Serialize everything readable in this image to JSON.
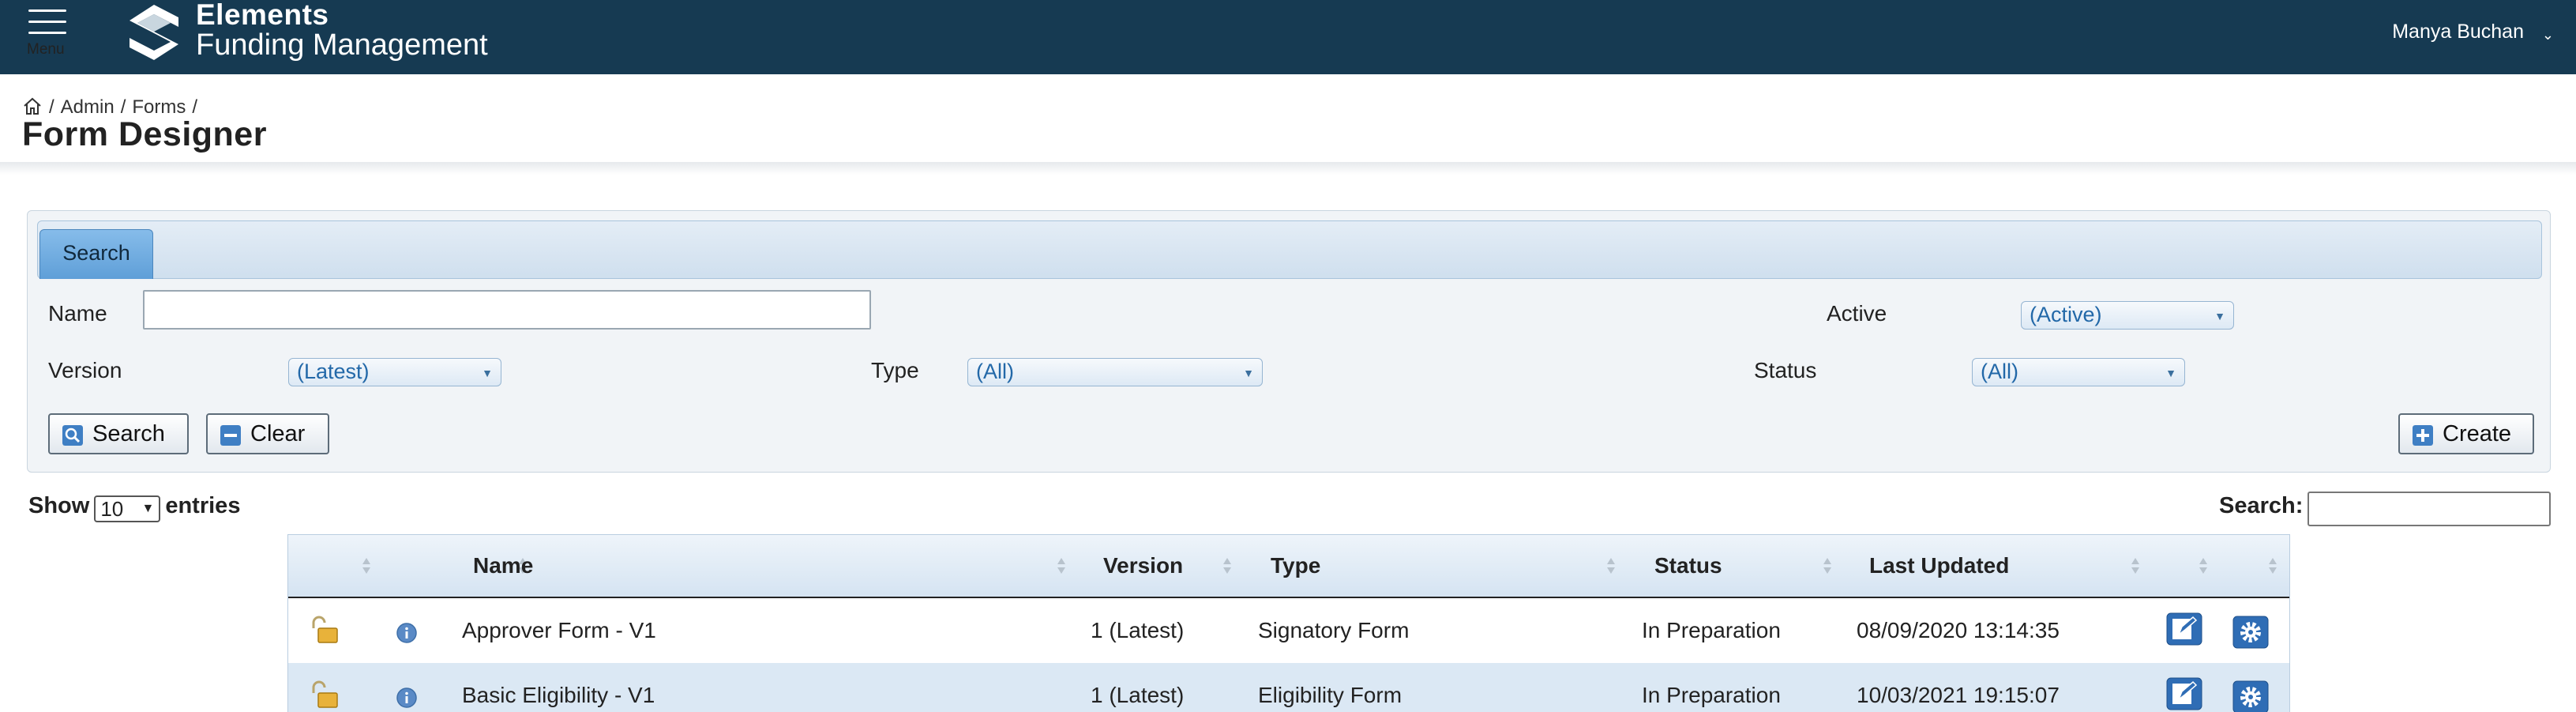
{
  "topbar": {
    "menu_label": "Menu",
    "brand_name": "Elements",
    "product_name": "Funding Management",
    "user_name": "Manya Buchan"
  },
  "breadcrumb": [
    "Admin",
    "Forms"
  ],
  "page_title": "Form Designer",
  "search_panel": {
    "tab_label": "Search",
    "name_label": "Name",
    "name_value": "",
    "active_label": "Active",
    "active_value": "(Active)",
    "version_label": "Version",
    "version_value": "(Latest)",
    "type_label": "Type",
    "type_value": "(All)",
    "status_label": "Status",
    "status_value": "(All)",
    "search_button": "Search",
    "clear_button": "Clear",
    "create_button": "Create"
  },
  "table_controls": {
    "show_label": "Show",
    "page_length": "10",
    "entries_label": "entries",
    "search_label": "Search:",
    "search_value": ""
  },
  "table": {
    "columns": [
      "",
      "",
      "Name",
      "Version",
      "Type",
      "Status",
      "Last Updated",
      "",
      ""
    ],
    "rows": [
      {
        "name": "Approver Form - V1",
        "version": "1 (Latest)",
        "type": "Signatory Form",
        "status": "In Preparation",
        "last_updated": "08/09/2020 13:14:35"
      },
      {
        "name": "Basic Eligibility - V1",
        "version": "1 (Latest)",
        "type": "Eligibility Form",
        "status": "In Preparation",
        "last_updated": "10/03/2021 19:15:07"
      }
    ]
  },
  "colors": {
    "topbar": "#163a52",
    "tab_active": "#5f9fd8",
    "select_text": "#2268a8",
    "row_alt": "#dbe8f4"
  },
  "icons": {
    "menu": "hamburger-icon",
    "logo": "elements-logo",
    "home": "home-icon",
    "lock": "unlocked-padlock-icon",
    "info": "info-icon",
    "edit": "edit-icon",
    "settings": "gear-icon"
  }
}
